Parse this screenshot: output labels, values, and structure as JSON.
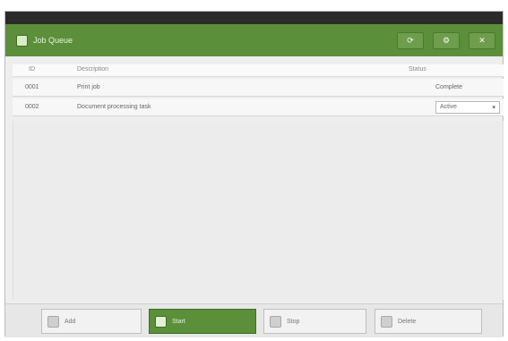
{
  "window": {
    "title": "Job Queue"
  },
  "toolbar": {
    "buttons": [
      {
        "icon": "refresh-icon",
        "glyph": "⟳"
      },
      {
        "icon": "settings-icon",
        "glyph": "⚙"
      },
      {
        "icon": "close-icon",
        "glyph": "✕"
      }
    ]
  },
  "columns": {
    "id": "ID",
    "name": "Description",
    "status": "Status"
  },
  "rows": [
    {
      "id": "0001",
      "name": "Print job",
      "status": "Complete",
      "select": "",
      "chevron": ""
    },
    {
      "id": "0002",
      "name": "Document processing task",
      "status": "",
      "select": "Active",
      "chevron": "▾"
    }
  ],
  "footer": {
    "buttons": [
      {
        "label": "Add",
        "icon": "add-icon"
      },
      {
        "label": "Start",
        "icon": "play-icon"
      },
      {
        "label": "Stop",
        "icon": "stop-icon"
      },
      {
        "label": "Delete",
        "icon": "delete-icon"
      }
    ]
  },
  "colors": {
    "accent": "#5b8f3a",
    "background": "#eeeeee"
  }
}
